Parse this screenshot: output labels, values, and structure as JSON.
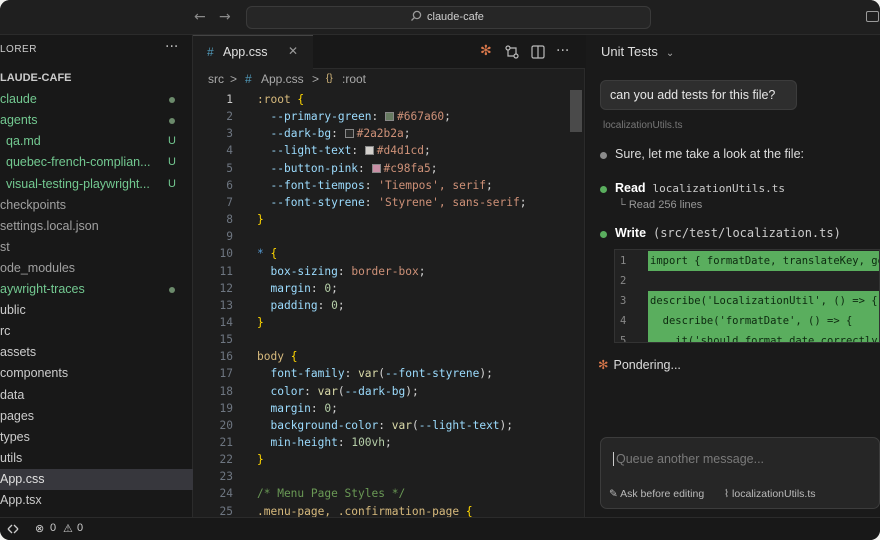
{
  "titlebar": {
    "search_icon": "search-icon",
    "workspace": "claude-cafe",
    "back": "←",
    "forward": "→"
  },
  "sidebar": {
    "title": "LORER",
    "more": "···",
    "items": [
      {
        "label": "LAUDE-CAFE",
        "status": "",
        "color": "#cccccc"
      },
      {
        "label": "claude",
        "status": "dot",
        "color": "#73c991"
      },
      {
        "label": "agents",
        "status": "dot",
        "color": "#73c991"
      },
      {
        "label": "qa.md",
        "status": "U",
        "color": "#73c991"
      },
      {
        "label": "quebec-french-complian...",
        "status": "U",
        "color": "#73c991"
      },
      {
        "label": "visual-testing-playwright...",
        "status": "U",
        "color": "#73c991"
      },
      {
        "label": "checkpoints",
        "status": "",
        "color": "#a0a0a0"
      },
      {
        "label": "settings.local.json",
        "status": "",
        "color": "#a0a0a0"
      },
      {
        "label": "st",
        "status": "",
        "color": "#a0a0a0"
      },
      {
        "label": "ode_modules",
        "status": "",
        "color": "#a0a0a0"
      },
      {
        "label": "aywright-traces",
        "status": "dot",
        "color": "#73c991"
      },
      {
        "label": "ublic",
        "status": "",
        "color": "#cccccc"
      },
      {
        "label": "rc",
        "status": "",
        "color": "#cccccc"
      },
      {
        "label": "assets",
        "status": "",
        "color": "#cccccc"
      },
      {
        "label": "components",
        "status": "",
        "color": "#cccccc"
      },
      {
        "label": "data",
        "status": "",
        "color": "#cccccc"
      },
      {
        "label": "pages",
        "status": "",
        "color": "#cccccc"
      },
      {
        "label": "types",
        "status": "",
        "color": "#cccccc"
      },
      {
        "label": "utils",
        "status": "",
        "color": "#cccccc"
      },
      {
        "label": "App.css",
        "status": "",
        "color": "#e0e0e0",
        "selected": true
      },
      {
        "label": "App.tsx",
        "status": "",
        "color": "#cccccc"
      }
    ]
  },
  "editor": {
    "tab": {
      "hash": "#",
      "name": "App.css",
      "close": "✕"
    },
    "breadcrumb": {
      "src": "src",
      "sep1": ">",
      "hash": "#",
      "file": "App.css",
      "sep2": ">",
      "symbol_icon": "{}",
      "symbol": ":root"
    },
    "line_numbers": [
      "1",
      "2",
      "3",
      "4",
      "5",
      "6",
      "7",
      "8",
      "9",
      "10",
      "11",
      "12",
      "13",
      "14",
      "15",
      "16",
      "17",
      "18",
      "19",
      "20",
      "21",
      "22",
      "23",
      "24",
      "25"
    ],
    "lines": [
      ":root {",
      "  --primary-green: #667a60;",
      "  --dark-bg: #2a2b2a;",
      "  --light-text: #d4d1cd;",
      "  --button-pink: #c98fa5;",
      "  --font-tiempos: 'Tiempos', serif;",
      "  --font-styrene: 'Styrene', sans-serif;",
      "}",
      "",
      "* {",
      "  box-sizing: border-box;",
      "  margin: 0;",
      "  padding: 0;",
      "}",
      "",
      "body {",
      "  font-family: var(--font-styrene);",
      "  color: var(--dark-bg);",
      "  margin: 0;",
      "  background-color: var(--light-text);",
      "  min-height: 100vh;",
      "}",
      "",
      "/* Menu Page Styles */",
      ".menu-page, .confirmation-page {"
    ],
    "swatches": [
      "#667a60",
      "#2a2b2a",
      "#d4d1cd",
      "#c98fa5"
    ]
  },
  "chat": {
    "title": "Unit Tests",
    "user_message": "can you add tests for this file?",
    "file_ref": "localizationUtils.ts",
    "assistant_text": "Sure, let me take a look at the file:",
    "read_label": "Read",
    "read_file": "localizationUtils.ts",
    "read_detail": "Read 256 lines",
    "write_label": "Write",
    "write_file": "(src/test/localization.ts)",
    "diff": [
      {
        "n": "1",
        "code": "import { formatDate, translateKey, ge",
        "added": true
      },
      {
        "n": "2",
        "code": "",
        "added": false
      },
      {
        "n": "3",
        "code": "describe('LocalizationUtil', () => {",
        "added": true
      },
      {
        "n": "4",
        "code": "  describe('formatDate', () => {",
        "added": true
      },
      {
        "n": "5",
        "code": "    it('should format date correctly'",
        "added": true
      }
    ],
    "status": "Pondering...",
    "composer_placeholder": "Queue another message...",
    "ask_label": "Ask before editing",
    "attach_label": "localizationUtils.ts"
  },
  "statusbar": {
    "errors": "0",
    "warnings": "0"
  },
  "colors": {
    "accent_green": "#5aae5e",
    "spark_orange": "#d9774a",
    "git_untracked": "#73c991"
  }
}
